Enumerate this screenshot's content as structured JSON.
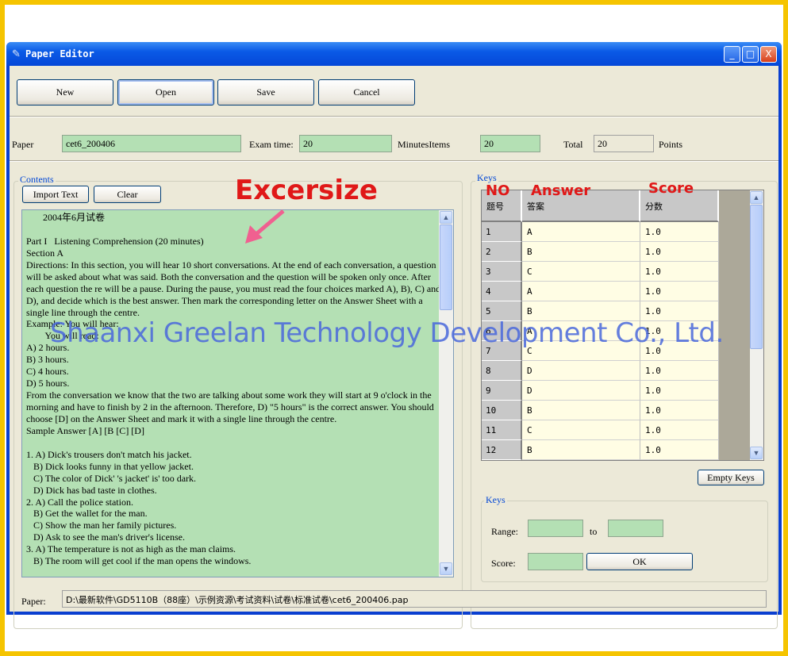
{
  "window": {
    "title": "Paper Editor",
    "minimize": "_",
    "maximize": "□",
    "close": "X"
  },
  "toolbar": {
    "new": "New",
    "open": "Open",
    "save": "Save",
    "cancel": "Cancel"
  },
  "paper_row": {
    "paper_label": "Paper",
    "paper_value": "cet6_200406",
    "exam_time_label": "Exam time:",
    "exam_time_value": "20",
    "minutes_items_label": "MinutesItems",
    "items_value": "20",
    "total_label": "Total",
    "total_value": "20",
    "points_label": "Points"
  },
  "contents": {
    "group_label": "Contents",
    "import_text": "Import Text",
    "clear": "Clear",
    "lines": [
      "       2004年6月试卷",
      "",
      "Part I   Listening Comprehension (20 minutes)",
      "Section A",
      "Directions: In this section, you will hear 10 short conversations. At the end of each conversation, a question",
      "will be asked about what was said. Both the conversation and the question will be spoken only once. After",
      "each question the re will be a pause. During the pause, you must read the four choices marked A), B), C) and",
      "D), and decide which is the best answer. Then mark the corresponding letter on the Answer Sheet with a",
      "single line through the centre.",
      "Example: You will hear:",
      "        You will read:",
      "A) 2 hours.",
      "B) 3 hours.",
      "C) 4 hours.",
      "D) 5 hours.",
      "From the conversation we know that the two are talking about some work they will start at 9 o'clock in the",
      "morning and have to finish by 2 in the afternoon. Therefore, D) \"5 hours\" is the correct answer. You should",
      "choose [D] on the Answer Sheet and mark it with a single line through the centre.",
      "Sample Answer [A] [B [C] [D]",
      "",
      "1. A) Dick's trousers don't match his jacket.",
      "   B) Dick looks funny in that yellow jacket.",
      "   C) The color of Dick' 's jacket' is' too dark.",
      "   D) Dick has bad taste in clothes.",
      "2. A) Call the police station.",
      "   B) Get the wallet for the man.",
      "   C) Show the man her family pictures.",
      "   D) Ask to see the man's driver's license.",
      "3. A) The temperature is not as high as the man claims.",
      "   B) The room will get cool if the man opens the windows."
    ]
  },
  "keys": {
    "group_label": "Keys",
    "columns": [
      "题号",
      "答案",
      "分数"
    ],
    "rows": [
      [
        "1",
        "A",
        "1.0"
      ],
      [
        "2",
        "B",
        "1.0"
      ],
      [
        "3",
        "C",
        "1.0"
      ],
      [
        "4",
        "A",
        "1.0"
      ],
      [
        "5",
        "B",
        "1.0"
      ],
      [
        "6",
        "A",
        "1.0"
      ],
      [
        "7",
        "C",
        "1.0"
      ],
      [
        "8",
        "D",
        "1.0"
      ],
      [
        "9",
        "D",
        "1.0"
      ],
      [
        "10",
        "B",
        "1.0"
      ],
      [
        "11",
        "C",
        "1.0"
      ],
      [
        "12",
        "B",
        "1.0"
      ]
    ],
    "empty_keys": "Empty Keys"
  },
  "keys_editor": {
    "group_label": "Keys",
    "range_label": "Range:",
    "to_label": "to",
    "score_label": "Score:",
    "range_from": "",
    "range_to": "",
    "score_value": "",
    "ok": "OK"
  },
  "status": {
    "paper_label": "Paper:",
    "path": "D:\\最新软件\\GD5110B（88座）\\示例资源\\考试资料\\试卷\\标准试卷\\cet6_200406.pap"
  },
  "annotations": {
    "excersize": "Excersize",
    "no": "NO",
    "answer": "Answer",
    "score": "Score",
    "watermark": "Shaanxi Greelan Technology Development Co., Ltd."
  },
  "colors": {
    "frame": "#f5c400",
    "input_green": "#b4e0b4",
    "grid_cell": "#fffde4",
    "annotation_red": "#e01818",
    "watermark_blue": "#4a68dc"
  }
}
